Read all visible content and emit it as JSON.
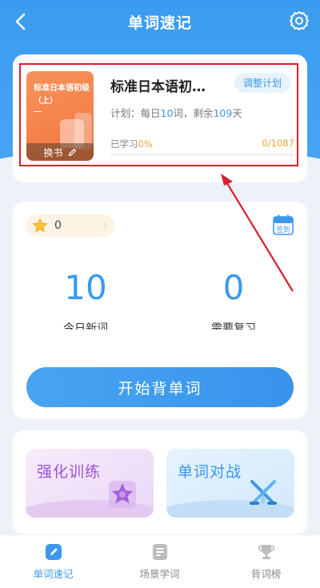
{
  "header": {
    "title": "单词速记",
    "back_icon": "chevron-left-icon",
    "settings_icon": "gear-icon"
  },
  "book": {
    "cover_title": "标准日本语初级（上）",
    "change_label": "换书",
    "name": "标准日本语初…",
    "adjust_label": "调整计划",
    "plan_prefix": "计划：每日",
    "daily_words": "10",
    "plan_mid": "词，剩余",
    "days_left": "109",
    "plan_suffix": "天",
    "studied_prefix": "已学习",
    "studied_percent": "0%",
    "count": "0/1087"
  },
  "stats": {
    "star_count": "0",
    "checkin_label": "签到",
    "new_words": "10",
    "new_words_label": "今日新词",
    "review": "0",
    "review_label": "需要复习"
  },
  "start_button": "开始背单词",
  "features": [
    {
      "title": "强化训练",
      "icon": "star-trophy-icon"
    },
    {
      "title": "单词对战",
      "icon": "crossed-swords-icon"
    }
  ],
  "tabs": [
    {
      "label": "单词速记",
      "icon": "pen-note-icon",
      "active": true
    },
    {
      "label": "场景学词",
      "icon": "list-doc-icon",
      "active": false
    },
    {
      "label": "背词榜",
      "icon": "trophy-icon",
      "active": false
    }
  ],
  "colors": {
    "accent": "#3b98ee",
    "highlight_box": "#d8202a",
    "cover": "#f3763f",
    "orange_text": "#f4a23b"
  }
}
